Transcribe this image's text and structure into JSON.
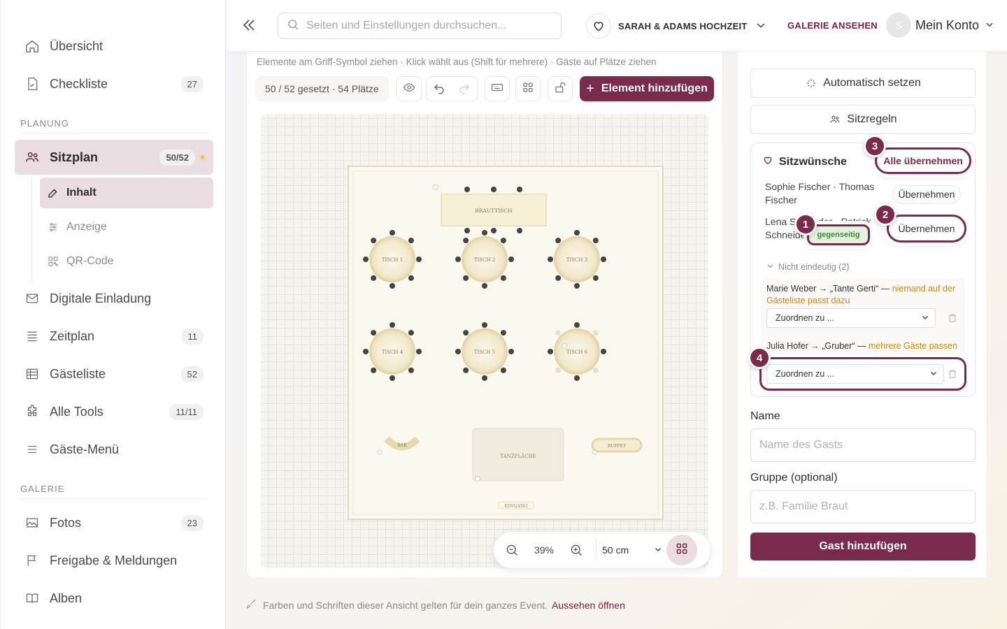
{
  "sidebar": {
    "items": [
      {
        "label": "Übersicht"
      },
      {
        "label": "Checkliste",
        "badge": "27"
      },
      {
        "label": "Sitzplan",
        "badge": "50/52"
      },
      {
        "label": "Digitale Einladung"
      },
      {
        "label": "Zeitplan",
        "badge": "11"
      },
      {
        "label": "Gästeliste",
        "badge": "52"
      },
      {
        "label": "Alle Tools",
        "badge": "11/11"
      },
      {
        "label": "Gäste-Menü"
      },
      {
        "label": "Fotos",
        "badge": "23"
      },
      {
        "label": "Freigabe & Meldungen"
      },
      {
        "label": "Alben"
      }
    ],
    "sections": {
      "planning": "PLANUNG",
      "gallery": "GALERIE"
    },
    "subitems": [
      {
        "label": "Inhalt"
      },
      {
        "label": "Anzeige"
      },
      {
        "label": "QR-Code"
      }
    ]
  },
  "header": {
    "search_placeholder": "Seiten und Einstellungen durchsuchen...",
    "event_name": "SARAH & ADAMS HOCHZEIT",
    "gallery_link": "GALERIE ANSEHEN",
    "avatar_initial": "S",
    "account_label": "Mein Konto"
  },
  "canvas": {
    "hint": "Elemente am Griff-Symbol ziehen · Klick wählt aus (Shift für mehrere) · Gäste auf Plätze ziehen",
    "stats": "50 / 52 gesetzt · 54 Plätze",
    "add_element": "Element hinzufügen",
    "zoom": "39%",
    "grid_size": "50 cm"
  },
  "floorplan": {
    "head_table": "BRAUTTISCH",
    "tables": [
      "TISCH 1",
      "TISCH 2",
      "TISCH 3",
      "TISCH 4",
      "TISCH 5",
      "TISCH 6"
    ],
    "bar": "BAR",
    "buffet": "BUFFET",
    "dancefloor": "TANZFLÄCHE",
    "entrance": "EINGANG"
  },
  "footer": {
    "note": "Farben und Schriften dieser Ansicht gelten für dein ganzes Event.",
    "link": "Aussehen öffnen"
  },
  "panel": {
    "auto_assign": "Automatisch setzen",
    "rules": "Sitzregeln",
    "wishes_title": "Sitzwünsche",
    "accept_all": "Alle übernehmen",
    "wish1": "Sophie Fischer · Thomas Fischer",
    "accept": "Übernehmen",
    "wish2a": "Lena S",
    "wish2b": "der · Patrick",
    "wish2c": "Schneide",
    "mutual": "gegenseitig",
    "unclear_label": "Nicht eindeutig (2)",
    "u1_text": "Marie Weber → „Tante Gerti“ — ",
    "u1_warn": "niemand auf der Gästeliste passt dazu",
    "u2_text": "Julia Hofer → „Gruber“ — ",
    "u2_warn": "mehrere Gäste passen auf den Namen",
    "assign_placeholder": "Zuordnen zu ...",
    "name_label": "Name",
    "name_placeholder": "Name des Gasts",
    "group_label": "Gruppe (optional)",
    "group_placeholder": "z.B. Familie Braut",
    "submit": "Gast hinzufügen",
    "steps": [
      "1",
      "2",
      "3",
      "4"
    ]
  },
  "colors": {
    "accent": "#7a2a4a",
    "accent_light": "#e9dde1",
    "warning": "#d98a00",
    "success": "#3b8c34"
  }
}
